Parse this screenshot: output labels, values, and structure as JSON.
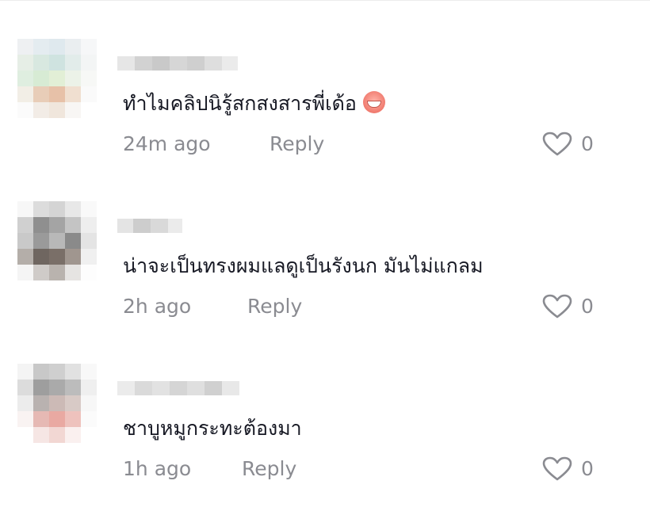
{
  "comments": [
    {
      "text": "ทำไมคลิปนิรู้สกสงสารพี่เด้อ",
      "emoji": "grinning-face-emoji",
      "time": "24m ago",
      "reply_label": "Reply",
      "like_count": "0",
      "like_icon": "heart-outline-icon"
    },
    {
      "text": "น่าจะเป็นทรงผมแลดูเป็นรังนก มันไม่แกลม",
      "time": "2h ago",
      "reply_label": "Reply",
      "like_count": "0",
      "like_icon": "heart-outline-icon"
    },
    {
      "text": "ชาบูหมูกระทะต้องมา",
      "time": "1h ago",
      "reply_label": "Reply",
      "like_count": "0",
      "like_icon": "heart-outline-icon"
    }
  ],
  "colors": {
    "text": "#161823",
    "secondary": "#8a8b91",
    "background": "#ffffff"
  }
}
